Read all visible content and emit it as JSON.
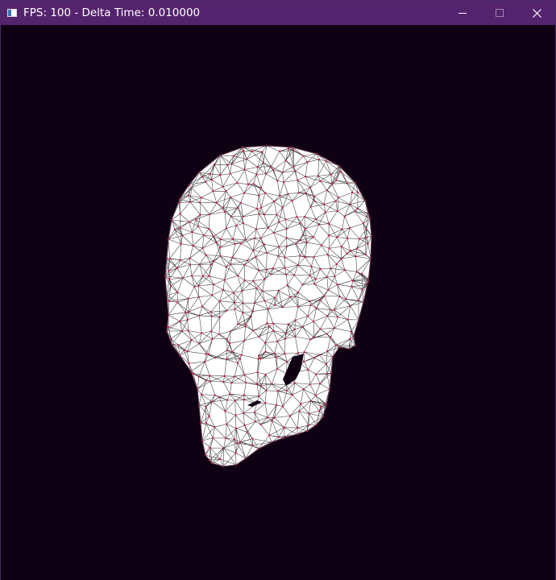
{
  "window": {
    "title": "FPS: 100 - Delta Time: 0.010000",
    "icon": "app-window-icon",
    "controls": {
      "minimize_icon": "minimize-icon",
      "maximize_icon": "maximize-icon",
      "close_icon": "close-icon"
    }
  },
  "viewport": {
    "background_color": "#0f0014",
    "mesh_fill_color": "#ffffff",
    "edge_color": "#333333",
    "vertex_color": "#d0143c",
    "model": "skull-wireframe"
  },
  "theme": {
    "titlebar_color": "#54236e"
  }
}
